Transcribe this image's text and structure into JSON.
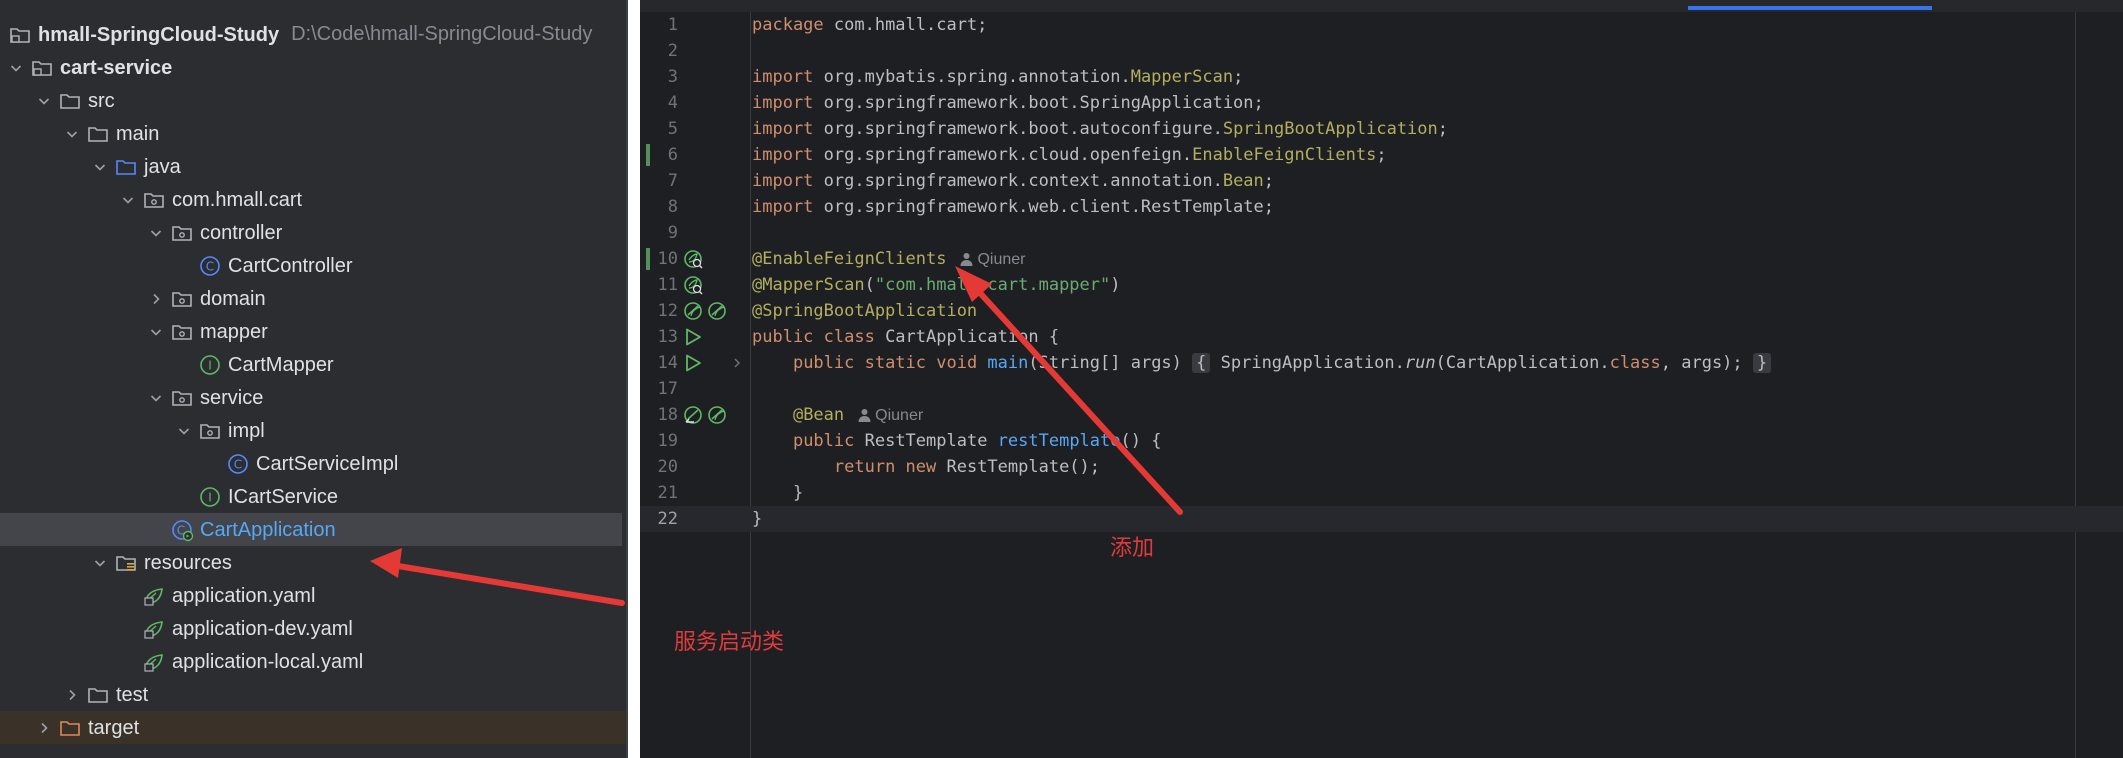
{
  "project": {
    "name": "hmall-SpringCloud-Study",
    "path": "D:\\Code\\hmall-SpringCloud-Study"
  },
  "tree": [
    {
      "label": "cart-service",
      "level": 0,
      "chevron": "down",
      "icon": "module-folder-icon",
      "bold": true
    },
    {
      "label": "src",
      "level": 1,
      "chevron": "down",
      "icon": "folder-icon"
    },
    {
      "label": "main",
      "level": 2,
      "chevron": "down",
      "icon": "folder-icon"
    },
    {
      "label": "java",
      "level": 3,
      "chevron": "down",
      "icon": "source-root-folder-icon"
    },
    {
      "label": "com.hmall.cart",
      "level": 4,
      "chevron": "down",
      "icon": "package-icon"
    },
    {
      "label": "controller",
      "level": 5,
      "chevron": "down",
      "icon": "package-icon"
    },
    {
      "label": "CartController",
      "level": 6,
      "chevron": "none",
      "icon": "class-icon"
    },
    {
      "label": "domain",
      "level": 5,
      "chevron": "right",
      "icon": "package-icon"
    },
    {
      "label": "mapper",
      "level": 5,
      "chevron": "down",
      "icon": "package-icon"
    },
    {
      "label": "CartMapper",
      "level": 6,
      "chevron": "none",
      "icon": "interface-icon"
    },
    {
      "label": "service",
      "level": 5,
      "chevron": "down",
      "icon": "package-icon"
    },
    {
      "label": "impl",
      "level": 6,
      "chevron": "down",
      "icon": "package-icon"
    },
    {
      "label": "CartServiceImpl",
      "level": 7,
      "chevron": "none",
      "icon": "class-icon"
    },
    {
      "label": "ICartService",
      "level": 6,
      "chevron": "none",
      "icon": "interface-icon"
    },
    {
      "label": "CartApplication",
      "level": 5,
      "chevron": "none",
      "icon": "spring-boot-class-icon",
      "selected": true
    },
    {
      "label": "resources",
      "level": 3,
      "chevron": "down",
      "icon": "resources-folder-icon"
    },
    {
      "label": "application.yaml",
      "level": 4,
      "chevron": "none",
      "icon": "spring-yaml-icon"
    },
    {
      "label": "application-dev.yaml",
      "level": 4,
      "chevron": "none",
      "icon": "spring-yaml-icon"
    },
    {
      "label": "application-local.yaml",
      "level": 4,
      "chevron": "none",
      "icon": "spring-yaml-icon"
    },
    {
      "label": "test",
      "level": 2,
      "chevron": "right",
      "icon": "folder-icon"
    },
    {
      "label": "target",
      "level": 1,
      "chevron": "right",
      "icon": "excluded-folder-icon",
      "dimmed": true
    }
  ],
  "editor": {
    "lines": [
      {
        "n": "1",
        "code": [
          [
            "kw",
            "package "
          ],
          [
            "",
            "com.hmall.cart;"
          ]
        ]
      },
      {
        "n": "2",
        "code": []
      },
      {
        "n": "3",
        "code": [
          [
            "kw",
            "import "
          ],
          [
            "",
            "org.mybatis.spring.annotation."
          ],
          [
            "ann",
            "MapperScan"
          ],
          [
            "",
            ";"
          ]
        ]
      },
      {
        "n": "4",
        "code": [
          [
            "kw",
            "import "
          ],
          [
            "",
            "org.springframework.boot.SpringApplication;"
          ]
        ]
      },
      {
        "n": "5",
        "code": [
          [
            "kw",
            "import "
          ],
          [
            "",
            "org.springframework.boot.autoconfigure."
          ],
          [
            "ann",
            "SpringBootApplication"
          ],
          [
            "",
            ";"
          ]
        ]
      },
      {
        "n": "6",
        "code": [
          [
            "kw",
            "import "
          ],
          [
            "",
            "org.springframework.cloud.openfeign."
          ],
          [
            "ann",
            "EnableFeignClients"
          ],
          [
            "",
            ";"
          ]
        ],
        "changed": true
      },
      {
        "n": "7",
        "code": [
          [
            "kw",
            "import "
          ],
          [
            "",
            "org.springframework.context.annotation."
          ],
          [
            "ann",
            "Bean"
          ],
          [
            "",
            ";"
          ]
        ]
      },
      {
        "n": "8",
        "code": [
          [
            "kw",
            "import "
          ],
          [
            "",
            "org.springframework.web.client.RestTemplate;"
          ]
        ]
      },
      {
        "n": "9",
        "code": []
      },
      {
        "n": "10",
        "code": [
          [
            "ann",
            "@EnableFeignClients"
          ]
        ],
        "author": "Qiuner",
        "changed": true,
        "gutter": [
          "bean-search-icon"
        ]
      },
      {
        "n": "11",
        "code": [
          [
            "ann",
            "@MapperScan"
          ],
          [
            "",
            "("
          ],
          [
            "str",
            "\"com.hmall.cart.mapper\""
          ],
          [
            "",
            ")"
          ]
        ],
        "gutter": [
          "bean-search-icon"
        ]
      },
      {
        "n": "12",
        "code": [
          [
            "ann",
            "@SpringBootApplication"
          ]
        ],
        "gutter": [
          "bean-icon",
          "bean-icon"
        ]
      },
      {
        "n": "13",
        "code": [
          [
            "kw",
            "public class "
          ],
          [
            "",
            "CartApplication {"
          ]
        ],
        "gutter": [
          "run-icon"
        ]
      },
      {
        "n": "14",
        "code": [
          [
            "",
            "    "
          ],
          [
            "kw",
            "public static void "
          ],
          [
            "fn",
            "main"
          ],
          [
            "",
            "(String[] args) "
          ],
          [
            "fold",
            "{"
          ],
          [
            "",
            " SpringApplication."
          ],
          [
            "it",
            "run"
          ],
          [
            "",
            "(CartApplication."
          ],
          [
            "kw",
            "class"
          ],
          [
            "",
            ", args); "
          ],
          [
            "fold",
            "}"
          ]
        ],
        "gutter": [
          "run-icon",
          "fold-chevron-icon"
        ]
      },
      {
        "n": "17",
        "code": []
      },
      {
        "n": "18",
        "code": [
          [
            "",
            "    "
          ],
          [
            "ann",
            "@Bean"
          ]
        ],
        "author": "Qiuner",
        "gutter": [
          "bean-return-icon",
          "bean-icon"
        ]
      },
      {
        "n": "19",
        "code": [
          [
            "",
            "    "
          ],
          [
            "kw",
            "public "
          ],
          [
            "",
            "RestTemplate "
          ],
          [
            "fn",
            "restTemplate"
          ],
          [
            "",
            "() {"
          ]
        ]
      },
      {
        "n": "20",
        "code": [
          [
            "",
            "        "
          ],
          [
            "kw",
            "return new "
          ],
          [
            "",
            "RestTemplate();"
          ]
        ]
      },
      {
        "n": "21",
        "code": [
          [
            "",
            "    }"
          ]
        ]
      },
      {
        "n": "22",
        "code": [
          [
            "",
            "}"
          ]
        ],
        "current": true
      }
    ]
  },
  "annotations": {
    "added_note": "添加",
    "launcher_note": "服务启动类"
  },
  "colors": {
    "arrow": "#e53935",
    "note": "#e03b3b"
  }
}
